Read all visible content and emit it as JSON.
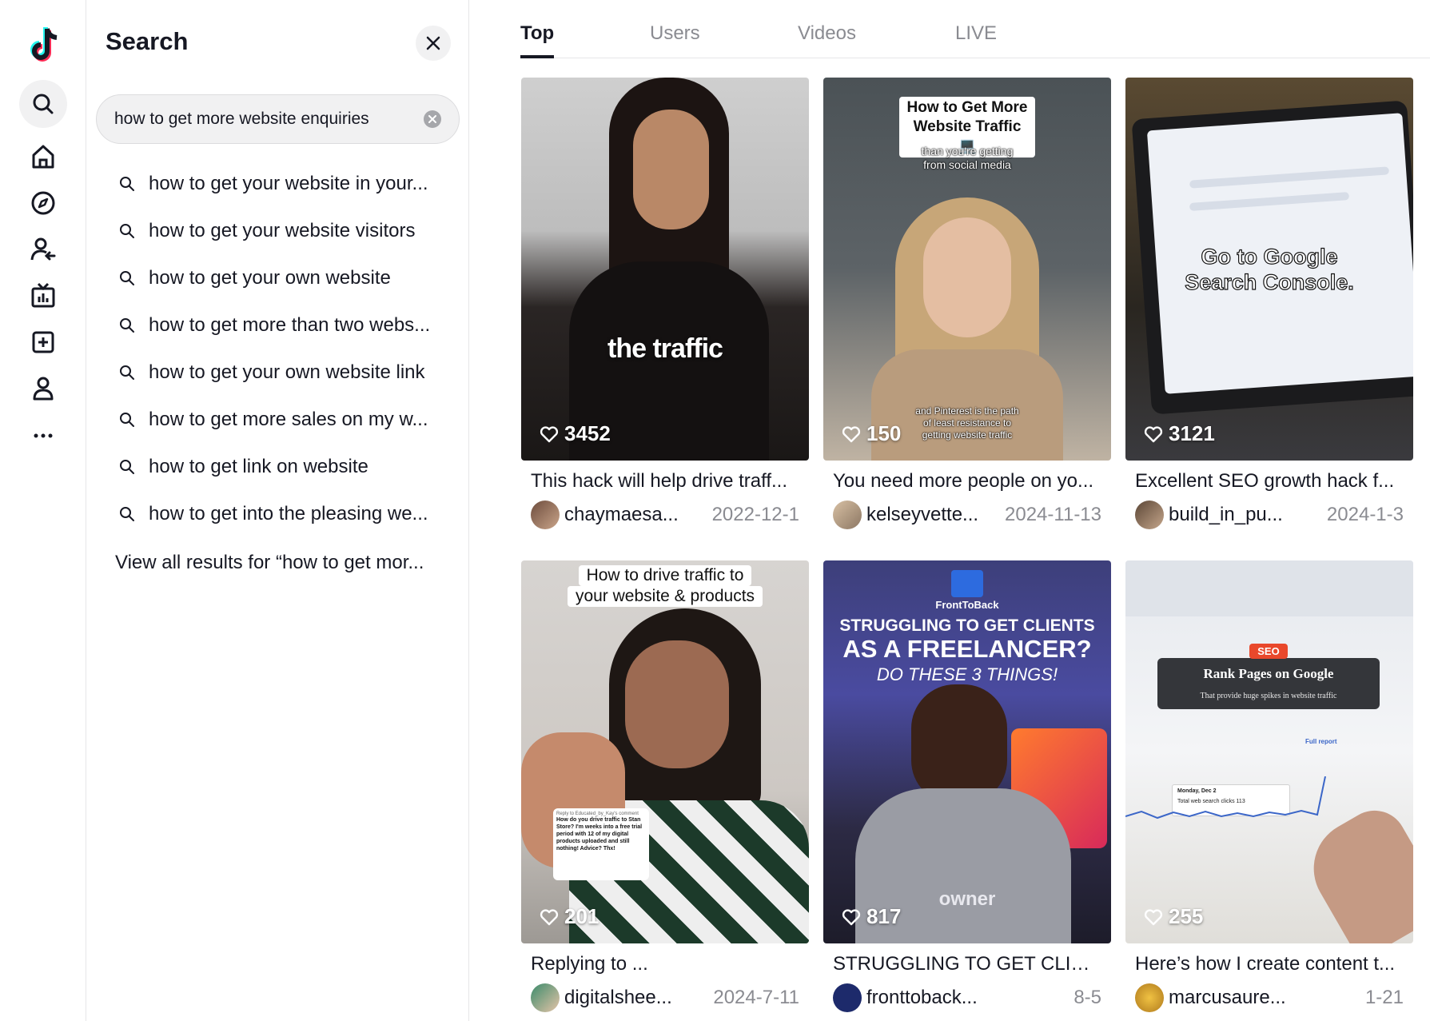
{
  "panel": {
    "title": "Search",
    "query": "how to get more website enquiries",
    "suggestions": [
      "how to get your website in your...",
      "how to get your website visitors",
      "how to get your own website",
      "how to get more than two webs...",
      "how to get your own website link",
      "how to get more sales on my w...",
      "how to get link on website",
      "how to get into the pleasing we..."
    ],
    "view_all": "View all results for “how to get mor..."
  },
  "tabs": [
    "Top",
    "Users",
    "Videos",
    "LIVE"
  ],
  "videos": [
    {
      "likes": "3452",
      "overlay": [
        "the traffic"
      ],
      "description": "This hack will help drive traff...",
      "username": "chaymaesa...",
      "date": "2022-12-1"
    },
    {
      "likes": "150",
      "overlay": [
        "How to Get More",
        "Website Traffic 💻",
        "than you're getting",
        "from social media",
        "and Pinterest is the path",
        "of least resistance to",
        "getting website traffic"
      ],
      "description": "You need more people on yo...",
      "username": "kelseyvette...",
      "date": "2024-11-13"
    },
    {
      "likes": "3121",
      "overlay": [
        "Go to Google",
        "Search Console."
      ],
      "description": "Excellent SEO growth hack f...",
      "username": "build_in_pu...",
      "date": "2024-1-3"
    },
    {
      "likes": "201",
      "overlay": [
        "How to drive traffic to",
        "your website & products",
        "Reply to Educated_by_Kay's comment",
        "How do you drive traffic to Stan Store? I'm weeks into a free trial period with 12 of my digital products uploaded and still nothing! Advice? Thx!"
      ],
      "description": "Replying to ...",
      "username": "digitalshee...",
      "date": "2024-7-11"
    },
    {
      "likes": "817",
      "overlay": [
        "FrontToBack",
        "STRUGGLING TO GET CLIENTS",
        "AS A FREELANCER?",
        "DO THESE 3 THINGS!",
        "owner"
      ],
      "description": "STRUGGLING TO GET CLIEN...",
      "username": "fronttoback...",
      "date": "8-5"
    },
    {
      "likes": "255",
      "overlay": [
        "SEO",
        "Rank Pages on Google",
        "That provide huge spikes in website traffic",
        "Full report",
        "Monday, Dec 2",
        "Total web search clicks",
        "113"
      ],
      "description": "Here’s how I create content t...",
      "username": "marcusaure...",
      "date": "1-21"
    }
  ],
  "colors": {
    "text": "#161823",
    "muted": "#8a8b91",
    "pill": "#f1f1f2"
  }
}
